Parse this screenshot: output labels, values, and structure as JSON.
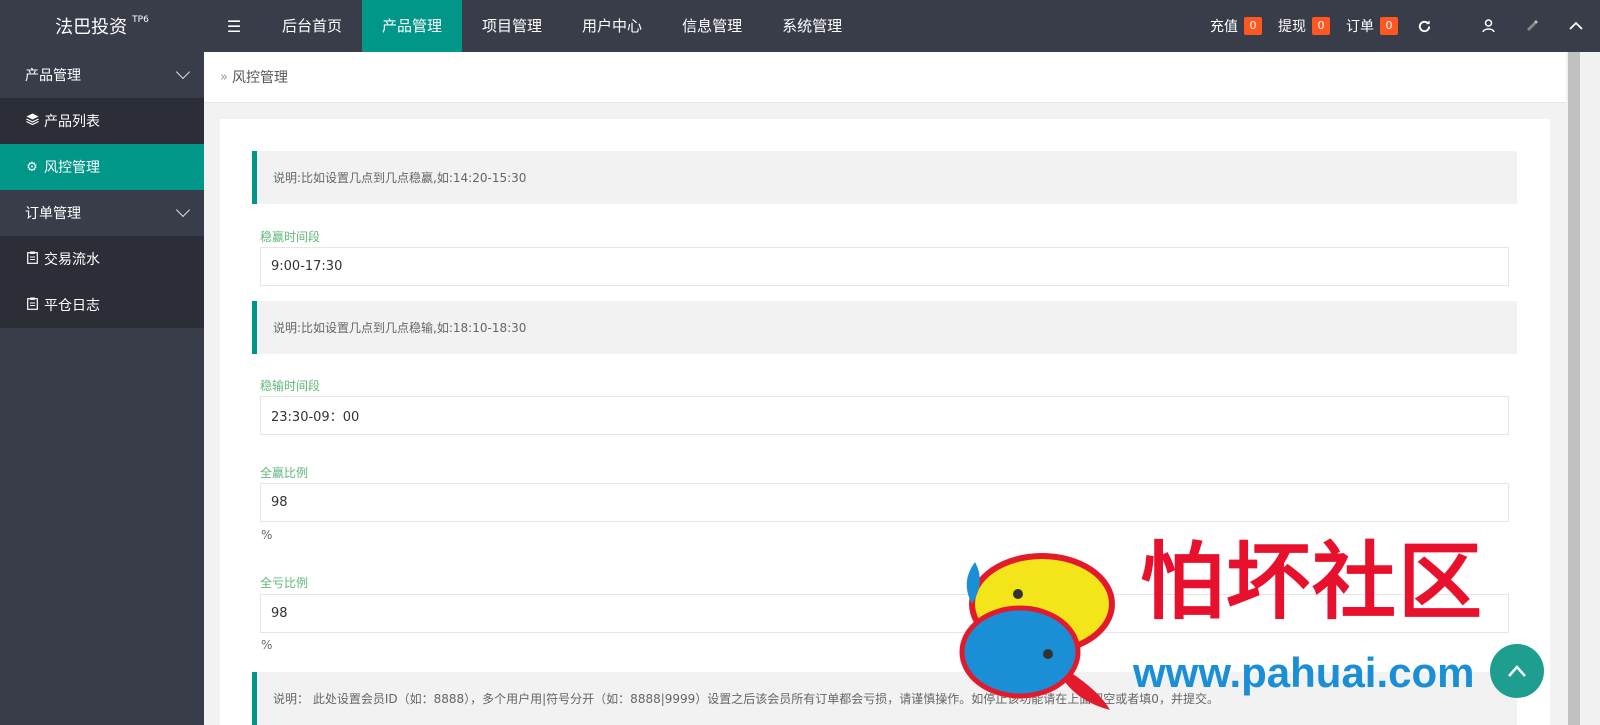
{
  "header": {
    "logo": "法巴投资",
    "logo_tag": "TP6",
    "menu_icon": "menu-icon",
    "nav": [
      {
        "label": "后台首页",
        "active": false
      },
      {
        "label": "产品管理",
        "active": true
      },
      {
        "label": "项目管理",
        "active": false
      },
      {
        "label": "用户中心",
        "active": false
      },
      {
        "label": "信息管理",
        "active": false
      },
      {
        "label": "系统管理",
        "active": false
      }
    ],
    "right": {
      "recharge_label": "充值",
      "recharge_count": "0",
      "withdraw_label": "提现",
      "withdraw_count": "0",
      "order_label": "订单",
      "order_count": "0",
      "icons": [
        "refresh-icon",
        "user-icon",
        "theme-icon",
        "collapse-icon"
      ]
    },
    "active_color": "#009688",
    "badge_color": "#ff5722"
  },
  "sidebar": {
    "groups": [
      {
        "label": "产品管理",
        "items": [
          {
            "label": "产品列表",
            "icon": "layers-icon",
            "active": false
          },
          {
            "label": "风控管理",
            "icon": "gear-icon",
            "active": true
          }
        ]
      },
      {
        "label": "订单管理",
        "items": [
          {
            "label": "交易流水",
            "icon": "clipboard-icon",
            "active": false
          },
          {
            "label": "平仓日志",
            "icon": "clipboard-icon",
            "active": false
          }
        ]
      }
    ]
  },
  "breadcrumb": {
    "current": "风控管理"
  },
  "form": {
    "note1": "说明:比如设置几点到几点稳赢,如:14:20-15:30",
    "win_period_label": "稳赢时间段",
    "win_period_value": "9:00-17:30",
    "note2": "说明:比如设置几点到几点稳输,如:18:10-18:30",
    "lose_period_label": "稳输时间段",
    "lose_period_value": "23:30-09：00",
    "win_ratio_label": "全赢比例",
    "win_ratio_value": "98",
    "win_ratio_unit": "%",
    "lose_ratio_label": "全亏比例",
    "lose_ratio_value": "98",
    "lose_ratio_unit": "%",
    "note3": "说明： 此处设置会员ID（如：8888），多个用户用|符号分开（如：8888|9999）设置之后该会员所有订单都会亏损，请谨慎操作。如停止该功能请在上面留空或者填0，并提交。"
  },
  "watermark": {
    "text": "怕坏社区",
    "url": "www.pahuai.com"
  }
}
